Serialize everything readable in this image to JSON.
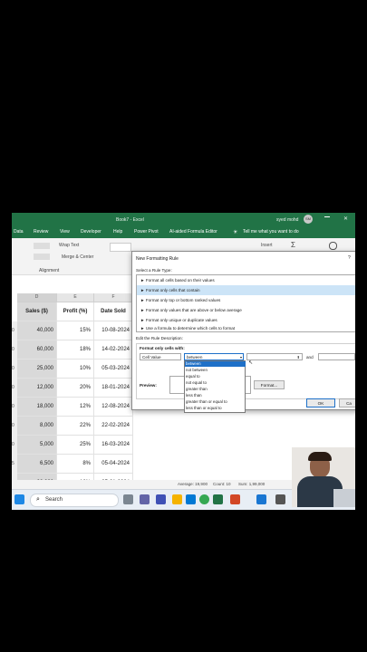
{
  "window": {
    "title": "Book7 - Excel",
    "user": "syed mohd",
    "user_initials": "SM"
  },
  "ribbon_tabs": [
    "Data",
    "Review",
    "View",
    "Developer",
    "Help",
    "Power Pivot",
    "AI-aided Formula Editor",
    "Tell me what you want to do"
  ],
  "ribbon": {
    "wrap_text": "Wrap Text",
    "merge_center": "Merge & Center",
    "alignment_group": "Alignment",
    "number_format": "Number",
    "insert": "Insert",
    "sigma": "Σ"
  },
  "sheet": {
    "columns": [
      "D",
      "E",
      "F"
    ],
    "headers": [
      "Sales ($)",
      "Profit (%)",
      "Date Sold"
    ],
    "row_stubs": [
      "0",
      "0",
      "0",
      "0",
      "0",
      "0",
      "0",
      "5",
      "0",
      "0",
      "0"
    ],
    "rows": [
      [
        "40,000",
        "15%",
        "10-08-2024"
      ],
      [
        "60,000",
        "18%",
        "14-02-2024"
      ],
      [
        "25,000",
        "10%",
        "05-03-2024"
      ],
      [
        "12,000",
        "20%",
        "18-01-2024"
      ],
      [
        "18,000",
        "12%",
        "12-08-2024"
      ],
      [
        "8,000",
        "22%",
        "22-02-2024"
      ],
      [
        "5,000",
        "25%",
        "16-03-2024"
      ],
      [
        "6,500",
        "8%",
        "05-04-2024"
      ],
      [
        "22,000",
        "16%",
        "25-01-2024"
      ],
      [
        "2,500",
        "30%",
        "25-03-2024"
      ]
    ]
  },
  "status_bar": {
    "average": "Average: 19,900",
    "count": "Count: 10",
    "sum": "Sum: 1,99,000"
  },
  "dialog": {
    "title": "New Formatting Rule",
    "close": "?",
    "select_rule_label": "Select a Rule Type:",
    "rule_types": [
      "► Format all cells based on their values",
      "► Format only cells that contain",
      "► Format only top or bottom ranked values",
      "► Format only values that are above or below average",
      "► Format only unique or duplicate values",
      "► Use a formula to determine which cells to format"
    ],
    "selected_rule_index": 1,
    "edit_label": "Edit the Rule Description:",
    "format_only_label": "Format only cells with:",
    "cell_value": "Cell Value",
    "operator": "between",
    "and_label": "and",
    "preview_label": "Preview:",
    "format_button": "Format...",
    "ok_button": "OK",
    "cancel_button": "Ca",
    "operator_options": [
      "between",
      "not between",
      "equal to",
      "not equal to",
      "greater than",
      "less than",
      "greater than or equal to",
      "less than or equal to"
    ]
  },
  "taskbar": {
    "search_placeholder": "Search"
  }
}
